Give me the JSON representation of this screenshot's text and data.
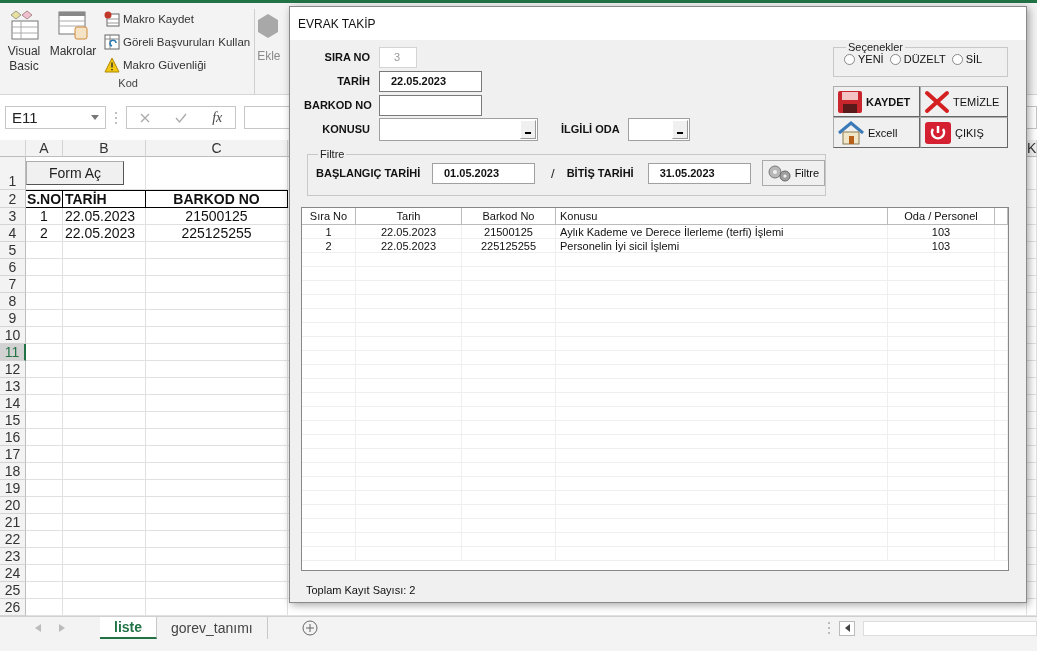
{
  "ribbon": {
    "group_label": "Kod",
    "large_buttons": [
      {
        "label": "Visual Basic"
      },
      {
        "label": "Makrolar"
      }
    ],
    "small_buttons": [
      {
        "label": "Makro Kaydet"
      },
      {
        "label": "Göreli Başvuruları Kullan"
      },
      {
        "label": "Makro Güvenliği"
      }
    ],
    "next_button": "Ekle"
  },
  "formula_bar": {
    "name_box": "E11",
    "function_label": "fx"
  },
  "sheet": {
    "columns": [
      "A",
      "B",
      "C",
      "K"
    ],
    "rows": [
      {
        "number": "1",
        "selected": false,
        "kind": "button",
        "button": "Form Aç"
      },
      {
        "number": "2",
        "selected": false,
        "kind": "header",
        "cells": [
          "S.NO",
          "TARİH",
          "BARKOD NO"
        ]
      },
      {
        "number": "3",
        "selected": false,
        "kind": "data",
        "cells": [
          "1",
          "22.05.2023",
          "21500125"
        ]
      },
      {
        "number": "4",
        "selected": false,
        "kind": "data",
        "cells": [
          "2",
          "22.05.2023",
          "225125255"
        ]
      },
      {
        "number": "5",
        "selected": false
      },
      {
        "number": "6",
        "selected": false
      },
      {
        "number": "7",
        "selected": false
      },
      {
        "number": "8",
        "selected": false
      },
      {
        "number": "9",
        "selected": false
      },
      {
        "number": "10",
        "selected": false
      },
      {
        "number": "11",
        "selected": true
      },
      {
        "number": "12",
        "selected": false
      },
      {
        "number": "13",
        "selected": false
      },
      {
        "number": "14",
        "selected": false
      },
      {
        "number": "15",
        "selected": false
      },
      {
        "number": "16",
        "selected": false
      },
      {
        "number": "17",
        "selected": false
      },
      {
        "number": "18",
        "selected": false
      },
      {
        "number": "19",
        "selected": false
      },
      {
        "number": "20",
        "selected": false
      },
      {
        "number": "21",
        "selected": false
      },
      {
        "number": "22",
        "selected": false
      },
      {
        "number": "23",
        "selected": false
      },
      {
        "number": "24",
        "selected": false
      },
      {
        "number": "25",
        "selected": false
      },
      {
        "number": "26",
        "selected": false
      }
    ]
  },
  "sheet_tabs": [
    {
      "label": "liste",
      "selected": true
    },
    {
      "label": "gorev_tanımı",
      "selected": false
    }
  ],
  "form": {
    "title": "EVRAK TAKİP",
    "fields": [
      {
        "label": "SIRA NO",
        "value": "3",
        "kind": "short",
        "disabled": true
      },
      {
        "label": "TARİH",
        "value": "22.05.2023",
        "kind": "text",
        "disabled": false
      },
      {
        "label": "BARKOD NO",
        "kind": "text",
        "disabled": false
      },
      {
        "label": "KONUSU",
        "kind": "combo",
        "disabled": false
      }
    ],
    "room_field": {
      "label": "İLGİLİ ODA"
    },
    "filter": {
      "title": "Filtre",
      "start_label": "BAŞLANGIÇ TARİHİ",
      "start_value": "01.05.2023",
      "separator": "/",
      "end_label": "BİTİŞ TARİHİ",
      "end_value": "31.05.2023",
      "button": "Filtre"
    },
    "options": {
      "title": "Seçenekler",
      "items": [
        {
          "label": "YENİ",
          "selected": false
        },
        {
          "label": "DÜZELT",
          "selected": false
        },
        {
          "label": "SİL",
          "selected": false
        }
      ]
    },
    "buttons": [
      {
        "label": "KAYDET",
        "bold": true
      },
      {
        "label": "TEMİZLE",
        "bold": false
      },
      {
        "label": "Excell",
        "bold": false
      },
      {
        "label": "ÇIKIŞ",
        "bold": false
      }
    ],
    "list": {
      "columns": [
        "Sıra No",
        "Tarih",
        "Barkod No",
        "Konusu",
        "Oda / Personel"
      ],
      "rows": [
        [
          "1",
          "22.05.2023",
          "21500125",
          "Aylık Kademe ve Derece İlerleme (terfi) İşlemi",
          "103"
        ],
        [
          "2",
          "22.05.2023",
          "225125255",
          "Personelin İyi sicil İşlemi",
          "103"
        ]
      ]
    },
    "footer": "Toplam Kayıt Sayısı: 2"
  }
}
